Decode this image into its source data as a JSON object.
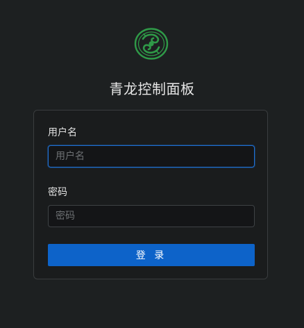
{
  "app": {
    "title": "青龙控制面板",
    "logo_icon": "qinglong-dragon-logo-icon",
    "accent_color": "#1f6fd1",
    "logo_color": "#2f9a48"
  },
  "form": {
    "username_label": "用户名",
    "username_placeholder": "用户名",
    "username_value": "",
    "password_label": "密码",
    "password_placeholder": "密码",
    "password_value": "",
    "submit_label": "登 录"
  }
}
